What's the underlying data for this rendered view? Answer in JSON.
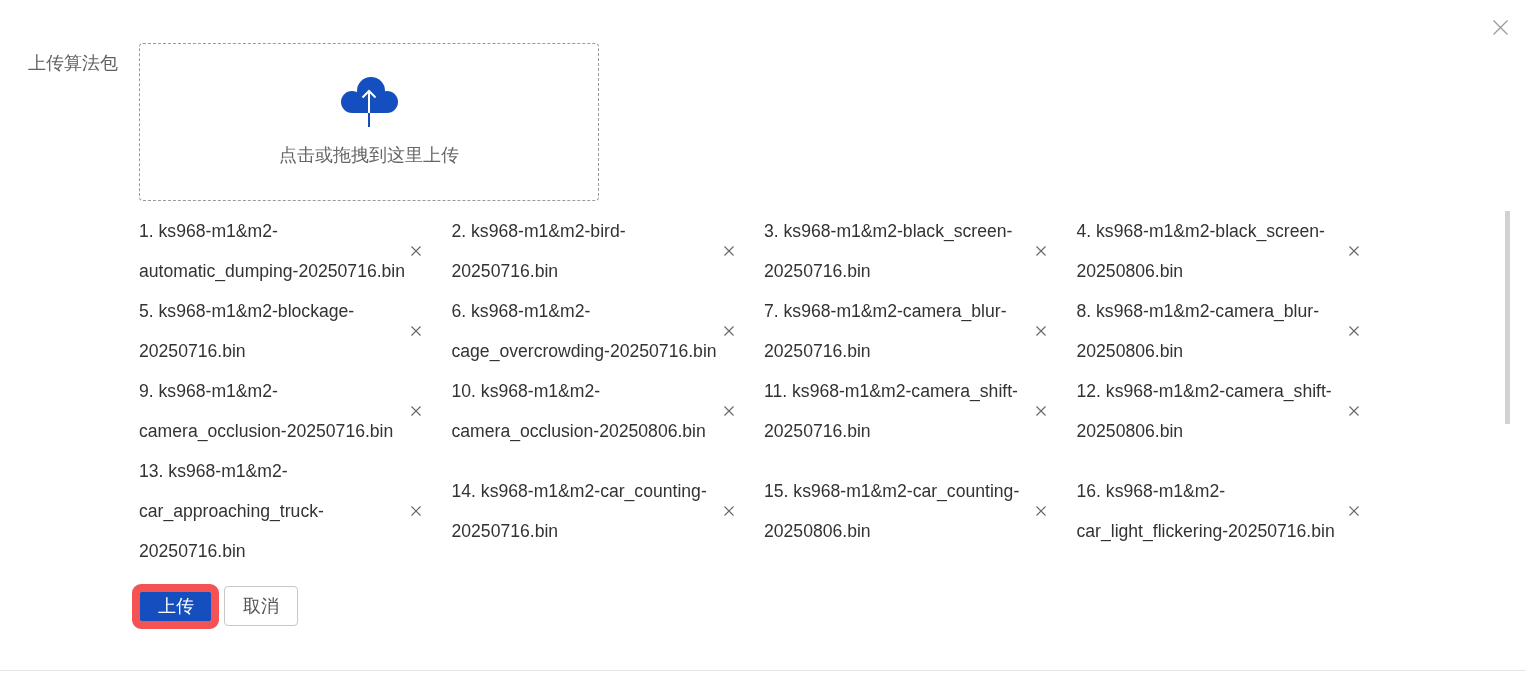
{
  "form": {
    "label": "上传算法包",
    "dropzone": {
      "hint": "点击或拖拽到这里上传"
    },
    "files": [
      "1. ks968-m1&m2-automatic_dumping-20250716.bin",
      "2. ks968-m1&m2-bird-20250716.bin",
      "3. ks968-m1&m2-black_screen-20250716.bin",
      "4. ks968-m1&m2-black_screen-20250806.bin",
      "5. ks968-m1&m2-blockage-20250716.bin",
      "6. ks968-m1&m2-cage_overcrowding-20250716.bin",
      "7. ks968-m1&m2-camera_blur-20250716.bin",
      "8. ks968-m1&m2-camera_blur-20250806.bin",
      "9. ks968-m1&m2-camera_occlusion-20250716.bin",
      "10. ks968-m1&m2-camera_occlusion-20250806.bin",
      "11. ks968-m1&m2-camera_shift-20250716.bin",
      "12. ks968-m1&m2-camera_shift-20250806.bin",
      "13. ks968-m1&m2-car_approaching_truck-20250716.bin",
      "14. ks968-m1&m2-car_counting-20250716.bin",
      "15. ks968-m1&m2-car_counting-20250806.bin",
      "16. ks968-m1&m2-car_light_flickering-20250716.bin"
    ]
  },
  "actions": [
    {
      "kind": "primary",
      "label": "上传",
      "highlighted": true
    },
    {
      "kind": "default",
      "label": "取消",
      "highlighted": false
    }
  ]
}
